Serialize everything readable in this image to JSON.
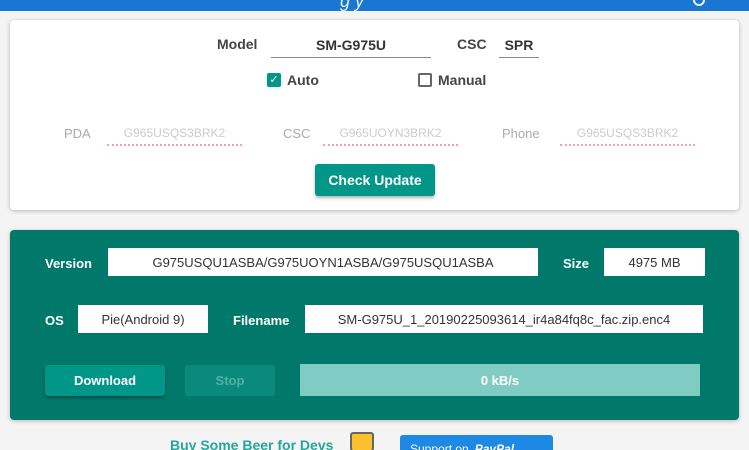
{
  "header": {
    "title_fragment": "g y"
  },
  "device": {
    "model_label": "Model",
    "model_value": "SM-G975U",
    "csc_label": "CSC",
    "csc_value": "SPR",
    "auto_label": "Auto",
    "auto_checked": true,
    "manual_label": "Manual",
    "manual_checked": false
  },
  "firmware": {
    "pda_label": "PDA",
    "pda_placeholder": "G965USQS3BRK2",
    "csc_label": "CSC",
    "csc_placeholder": "G965UOYN3BRK2",
    "phone_label": "Phone",
    "phone_placeholder": "G965USQS3BRK2"
  },
  "check_update_label": "Check Update",
  "result": {
    "version_label": "Version",
    "version_value": "G975USQU1ASBA/G975UOYN1ASBA/G975USQU1ASBA",
    "size_label": "Size",
    "size_value": "4975 MB",
    "os_label": "OS",
    "os_value": "Pie(Android 9)",
    "filename_label": "Filename",
    "filename_value": "SM-G975U_1_20190225093614_ir4a84fq8c_fac.zip.enc4"
  },
  "download_label": "Download",
  "stop_label": "Stop",
  "progress": {
    "speed_text": "0 kB/s",
    "fraction": 0
  },
  "footer": {
    "beer_text": "Buy Some Beer for Devs",
    "paypal_support": "Support on",
    "paypal_brand": "PayPal"
  },
  "colors": {
    "primary": "#009688",
    "dark_panel": "#00796b",
    "top_bar": "#1976d2",
    "paypal": "#1e88e5"
  }
}
